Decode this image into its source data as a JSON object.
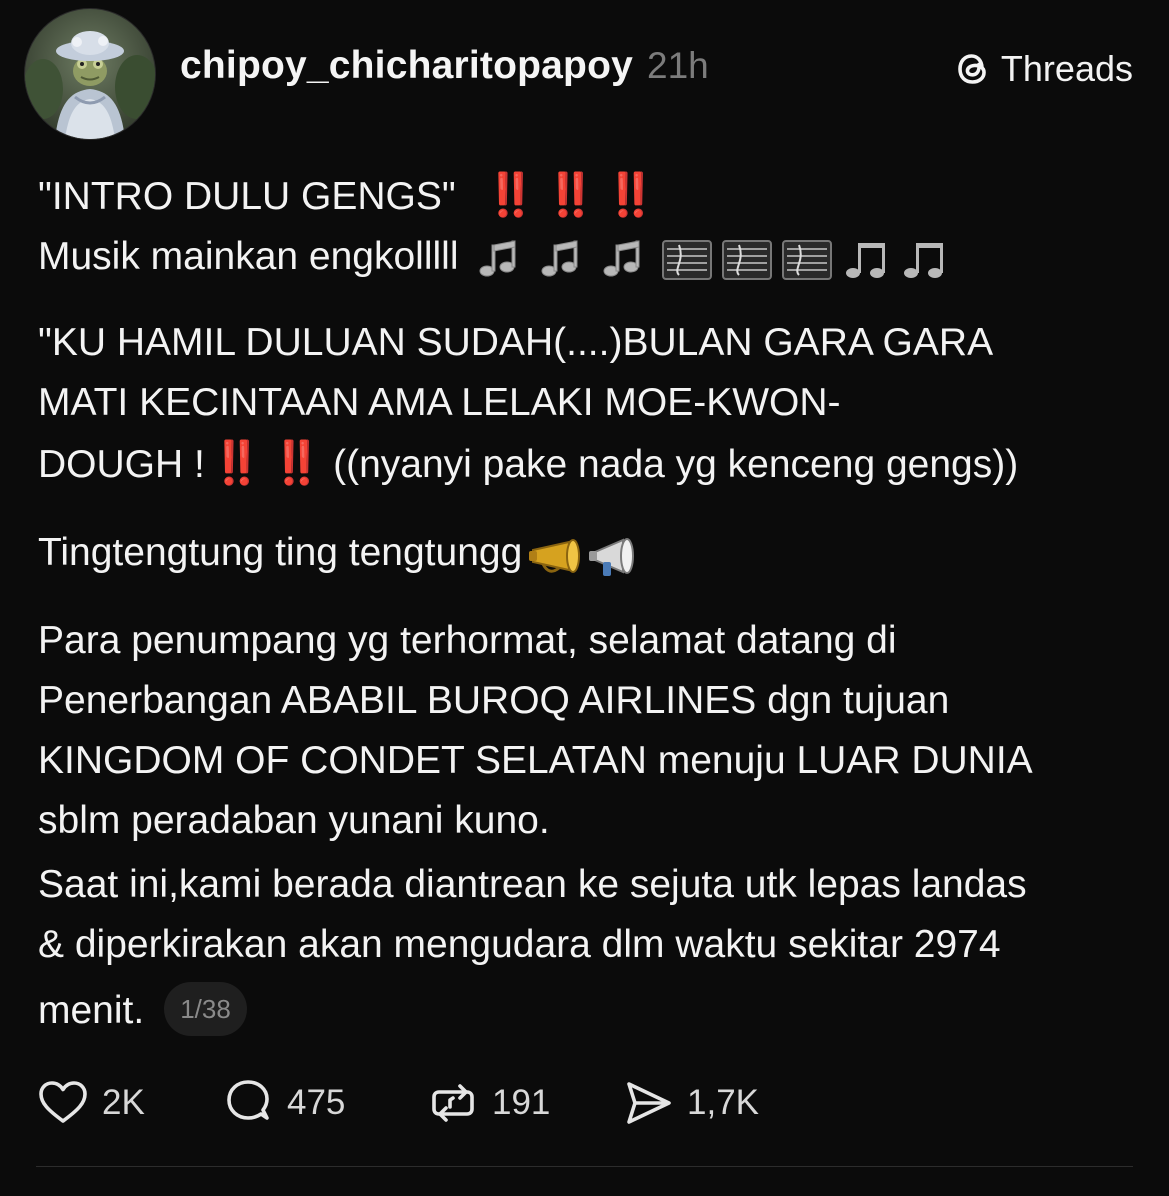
{
  "post": {
    "username": "chipoy_chicharitopapoy",
    "time": "21h",
    "brand": "Threads",
    "avatar_icon": "frog-portrait-avatar",
    "accent_bang_color": "#e3201b",
    "lines": {
      "l1_text": "\"INTRO DULU GENGS\"",
      "l1_bang": "‼️ ‼️ ‼️",
      "l2_text": "Musik mainkan engkolllll",
      "l3": "\"KU HAMIL DULUAN SUDAH(....)BULAN GARA GARA",
      "l4": "MATI KECINTAAN AMA LELAKI MOE-KWON-",
      "l5_pre": "DOUGH !",
      "l5_bang": "‼️ ‼️",
      "l5_post": "((nyanyi pake nada yg kenceng  gengs))",
      "l6": "Tingtengtung ting tengtungg",
      "l7": "Para penumpang yg terhormat, selamat datang di",
      "l8": "Penerbangan ABABIL BUROQ AIRLINES dgn tujuan",
      "l9": "KINGDOM OF CONDET SELATAN menuju LUAR DUNIA",
      "l10": "sblm peradaban yunani kuno.",
      "l11": "Saat ini,kami berada diantrean ke sejuta utk lepas landas",
      "l12": "& diperkirakan akan mengudara dlm waktu sekitar 2974",
      "l13": "menit."
    },
    "page_indicator": "1/38"
  },
  "actions": {
    "like_count": "2K",
    "reply_count": "475",
    "repost_count": "191",
    "share_count": "1,7K"
  }
}
